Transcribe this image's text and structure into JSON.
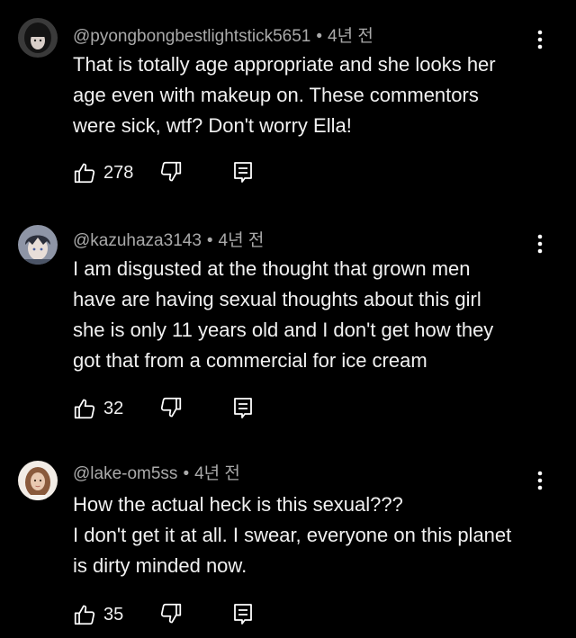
{
  "comments": [
    {
      "handle": "@pyongbongbestlightstick5651",
      "separator": "•",
      "time": "4년 전",
      "text": "That is totally age appropriate and she looks her\nage even with makeup on. These commentors\nwere sick, wtf? Don't worry Ella!",
      "likes": "278",
      "avatar_icon": "dark-haired-avatar-icon"
    },
    {
      "handle": "@kazuhaza3143",
      "separator": "•",
      "time": "4년 전",
      "text": "I am disgusted at the thought that grown men\nhave are having sexual thoughts about this girl\nshe is only 11 years old and I don't get how they\ngot that from a  commercial for ice cream",
      "likes": "32",
      "avatar_icon": "anime-character-avatar-icon"
    },
    {
      "handle": "@lake-om5ss",
      "separator": "•",
      "time": "4년 전",
      "text": "How the actual heck is this sexual???\nI don't get it at all. I swear, everyone on this planet\nis dirty minded now.",
      "likes": "35",
      "avatar_icon": "portrait-avatar-icon"
    }
  ],
  "icons": {
    "like": "thumbs-up-icon",
    "dislike": "thumbs-down-icon",
    "reply": "reply-icon",
    "menu": "more-vertical-icon"
  },
  "colors": {
    "background": "#000000",
    "text": "#f1f1f1",
    "meta": "#aaaaaa"
  }
}
